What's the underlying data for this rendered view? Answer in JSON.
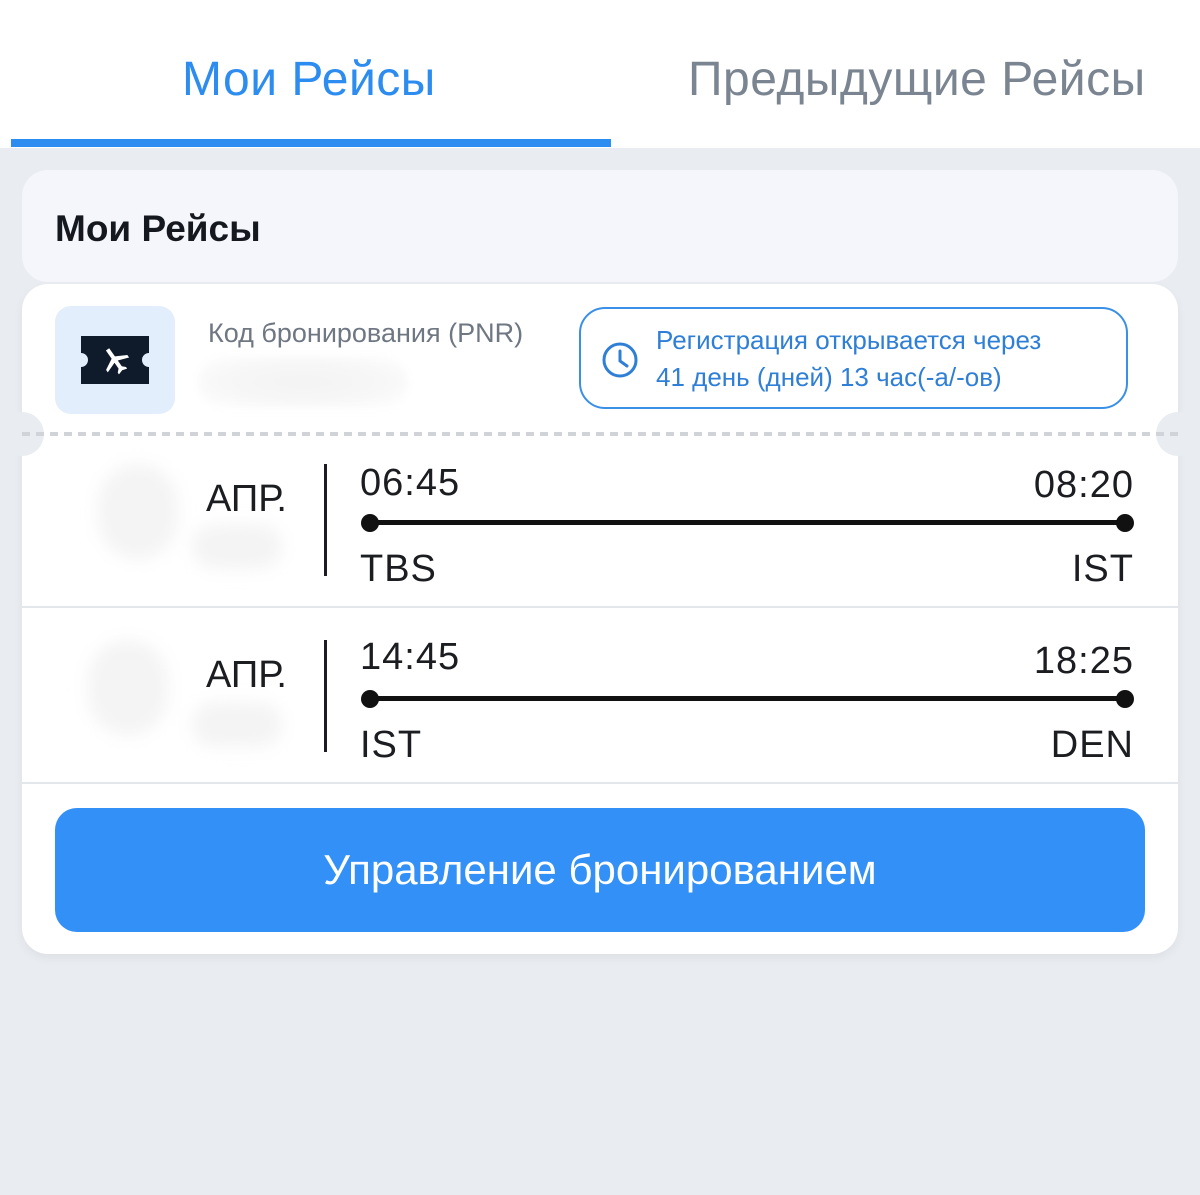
{
  "tabs": [
    {
      "label": "Мои Рейсы",
      "active": true
    },
    {
      "label": "Предыдущие Рейсы",
      "active": false
    }
  ],
  "section": {
    "title": "Мои Рейсы"
  },
  "booking": {
    "pnr_label": "Код бронирования (PNR)",
    "icon": "ticket-plane-icon",
    "checkin": {
      "icon": "clock-icon",
      "line1": "Регистрация открывается через",
      "line2": "41 день (дней) 13 час(-а/-ов)"
    }
  },
  "segments": [
    {
      "month": "АПР.",
      "dep_time": "06:45",
      "arr_time": "08:20",
      "from": "TBS",
      "to": "IST"
    },
    {
      "month": "АПР.",
      "dep_time": "14:45",
      "arr_time": "18:25",
      "from": "IST",
      "to": "DEN"
    }
  ],
  "actions": {
    "manage_label": "Управление бронированием"
  },
  "colors": {
    "accent": "#2d8cf0",
    "button": "#3390f7",
    "inactive_tab": "#7a8591",
    "background": "#e9ecf0"
  }
}
